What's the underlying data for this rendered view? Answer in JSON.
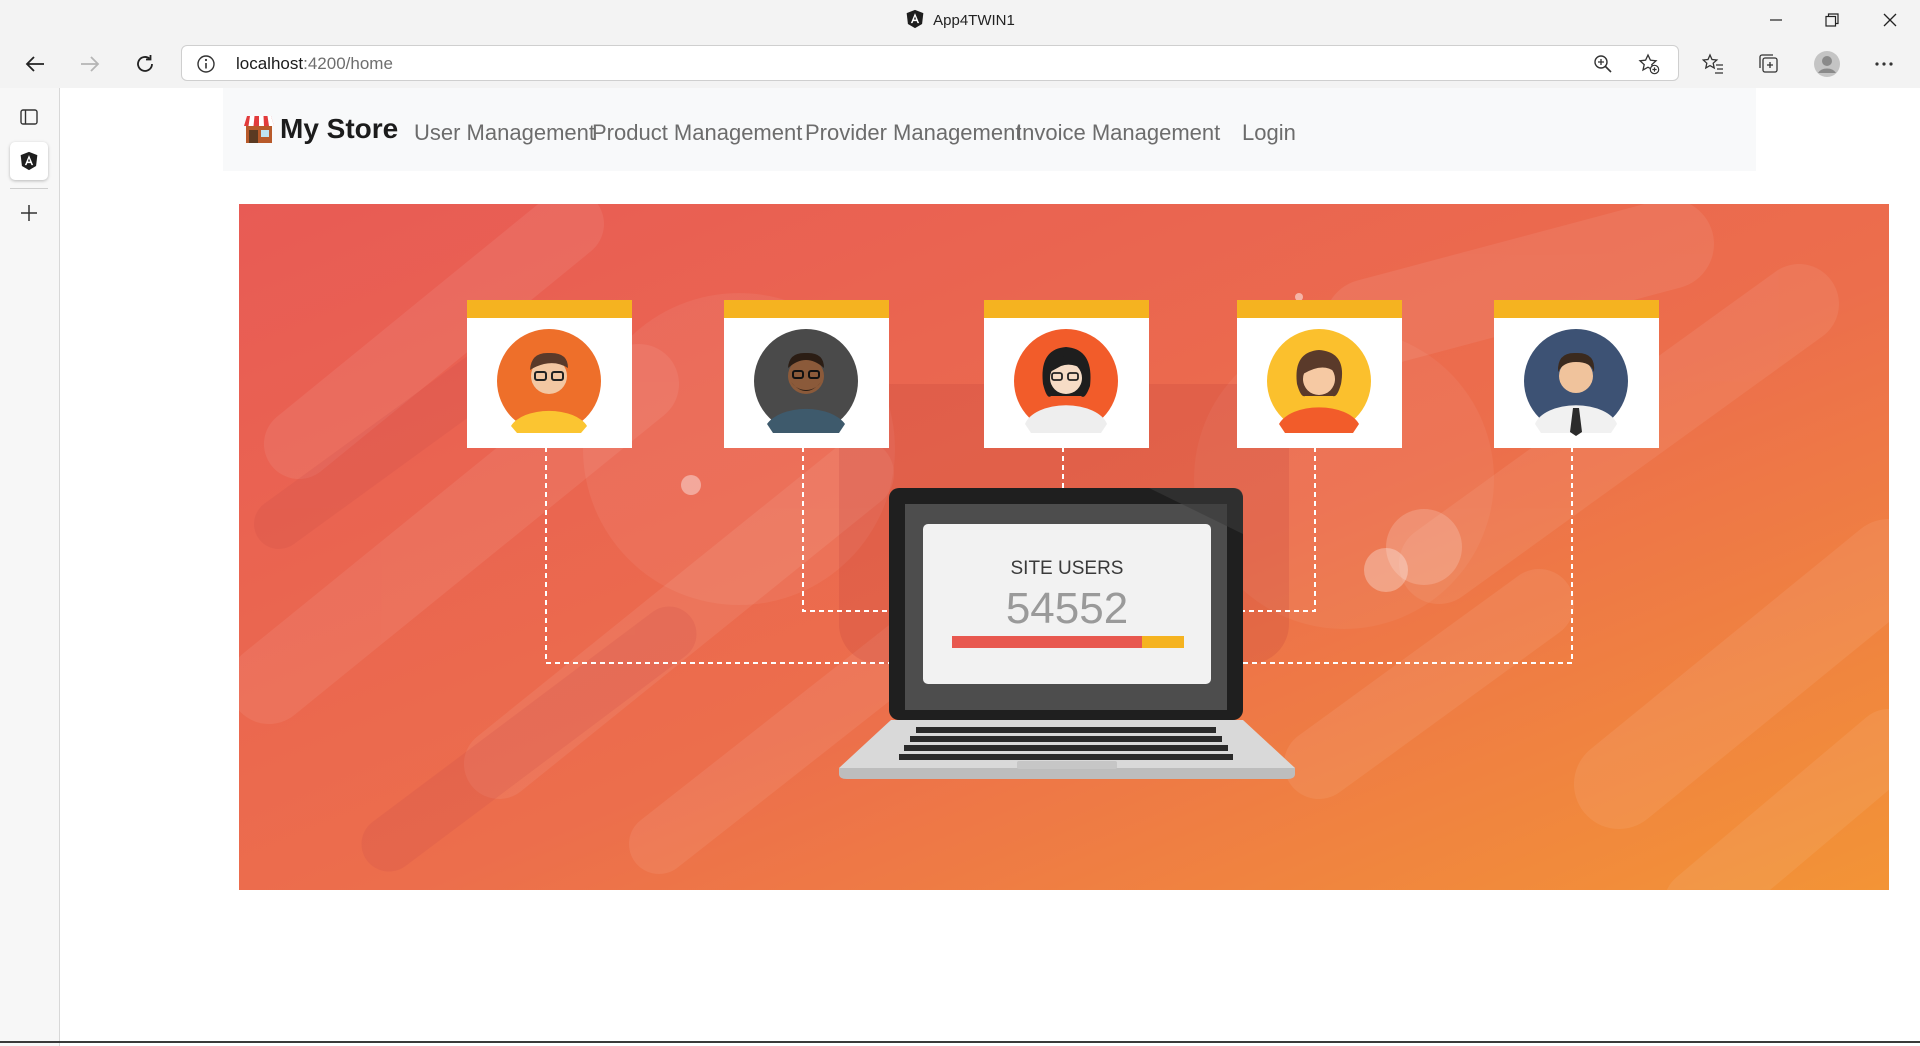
{
  "window": {
    "title": "App4TWIN1",
    "controls": [
      "minimize",
      "restore",
      "close"
    ]
  },
  "browser": {
    "address": {
      "host": "localhost",
      "path": ":4200/home"
    },
    "icons": [
      "back-icon",
      "forward-icon",
      "refresh-icon",
      "site-info-icon",
      "zoom-icon",
      "add-favorite-icon",
      "favorites-icon",
      "collections-icon",
      "profile-icon",
      "more-icon"
    ]
  },
  "sidebar": {
    "tabs": [
      "tab-actions-icon",
      "angular-tab-icon",
      "new-tab-icon"
    ]
  },
  "navbar": {
    "brand": "My Store",
    "links": [
      "User Management",
      "Product Management",
      "Provider Management",
      "Invoice Management",
      "Login"
    ]
  },
  "hero": {
    "caption": "SITE USERS",
    "count": "54552",
    "progress": 0.82,
    "colors": {
      "gradient_start": "#e85b55",
      "gradient_end": "#f39436",
      "accent": "#f5b320",
      "bar": "#e8584f"
    }
  }
}
